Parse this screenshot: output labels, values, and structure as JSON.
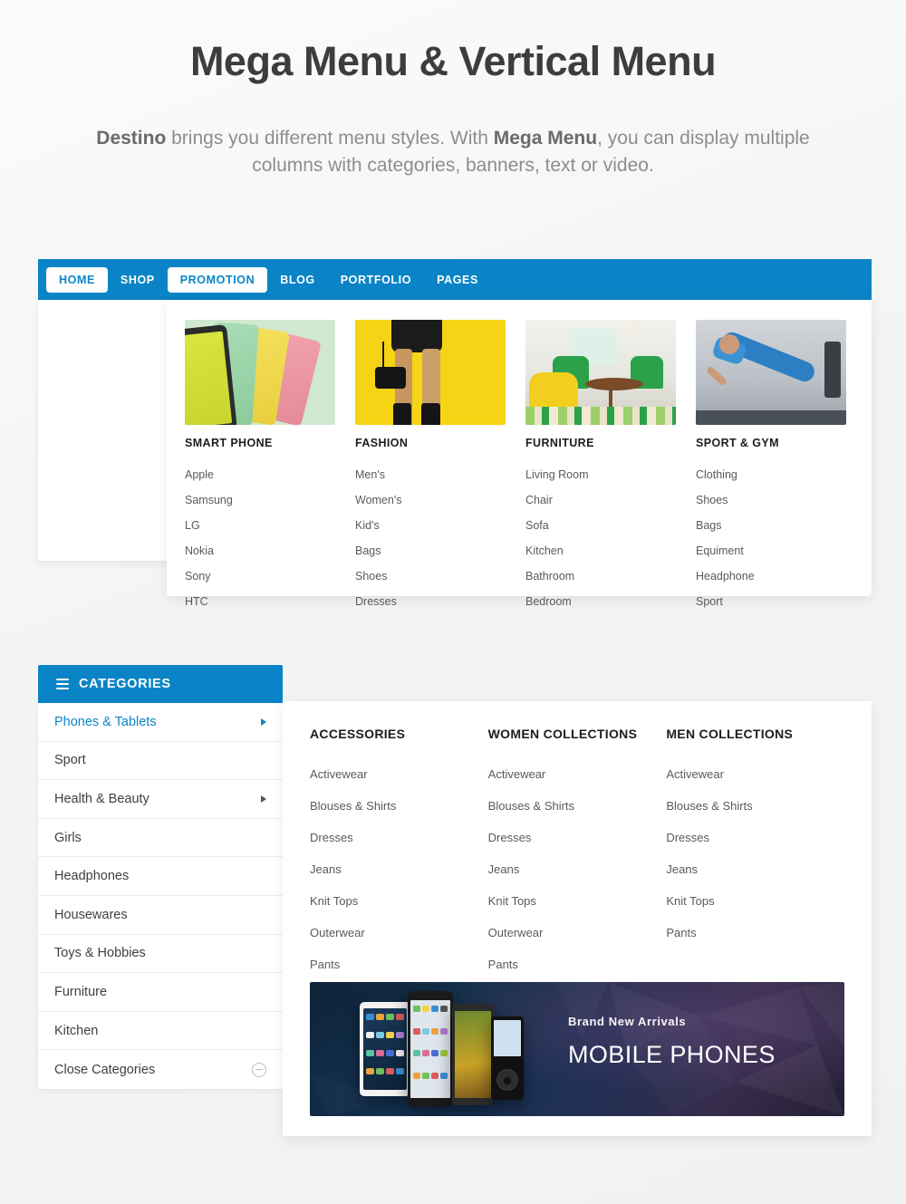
{
  "hero": {
    "title": "Mega Menu & Vertical Menu",
    "sub_pre": "",
    "sub_brand": "Destino",
    "sub_mid": " brings you different menu styles. With ",
    "sub_bold": "Mega Menu",
    "sub_post": ", you can display multiple columns with categories, banners, text or video."
  },
  "navbar": {
    "items": [
      {
        "label": "HOME",
        "active": true
      },
      {
        "label": "SHOP",
        "active": false
      },
      {
        "label": "PROMOTION",
        "active": true
      },
      {
        "label": "BLOG",
        "active": false
      },
      {
        "label": "PORTFOLIO",
        "active": false
      },
      {
        "label": "PAGES",
        "active": false
      }
    ],
    "accent_color": "#0a84c6"
  },
  "mega_menu": {
    "columns": [
      {
        "title": "SMART PHONE",
        "image": "smartphones-photo",
        "links": [
          "Apple",
          "Samsung",
          "LG",
          "Nokia",
          "Sony",
          "HTC"
        ]
      },
      {
        "title": "FASHION",
        "image": "fashion-photo",
        "links": [
          "Men's",
          "Women's",
          "Kid's",
          "Bags",
          "Shoes",
          "Dresses"
        ]
      },
      {
        "title": "FURNITURE",
        "image": "furniture-photo",
        "links": [
          "Living Room",
          "Chair",
          "Sofa",
          "Kitchen",
          "Bathroom",
          "Bedroom"
        ]
      },
      {
        "title": "SPORT & GYM",
        "image": "sport-gym-photo",
        "links": [
          "Clothing",
          "Shoes",
          "Bags",
          "Equiment",
          "Headphone",
          "Sport"
        ]
      }
    ]
  },
  "vertical_menu": {
    "header": "CATEGORIES",
    "items": [
      {
        "label": "Phones & Tablets",
        "active": true,
        "arrow": true
      },
      {
        "label": "Sport",
        "active": false,
        "arrow": false
      },
      {
        "label": "Health & Beauty",
        "active": false,
        "arrow": true
      },
      {
        "label": "Girls",
        "active": false,
        "arrow": false
      },
      {
        "label": "Headphones",
        "active": false,
        "arrow": false
      },
      {
        "label": "Housewares",
        "active": false,
        "arrow": false
      },
      {
        "label": "Toys & Hobbies",
        "active": false,
        "arrow": false
      },
      {
        "label": "Furniture",
        "active": false,
        "arrow": false
      },
      {
        "label": "Kitchen",
        "active": false,
        "arrow": false
      },
      {
        "label": "Close Categories",
        "active": false,
        "arrow": false,
        "minus": true
      }
    ],
    "columns": [
      {
        "title": "ACCESSORIES",
        "links": [
          "Activewear",
          "Blouses & Shirts",
          "Dresses",
          "Jeans",
          "Knit Tops",
          "Outerwear",
          "Pants"
        ]
      },
      {
        "title": "WOMEN COLLECTIONS",
        "links": [
          "Activewear",
          "Blouses & Shirts",
          "Dresses",
          "Jeans",
          "Knit Tops",
          "Outerwear",
          "Pants"
        ]
      },
      {
        "title": "MEN COLLECTIONS",
        "links": [
          "Activewear",
          "Blouses & Shirts",
          "Dresses",
          "Jeans",
          "Knit Tops",
          "Pants"
        ]
      }
    ],
    "banner": {
      "kicker": "Brand New Arrivals",
      "title": "MOBILE PHONES"
    }
  }
}
